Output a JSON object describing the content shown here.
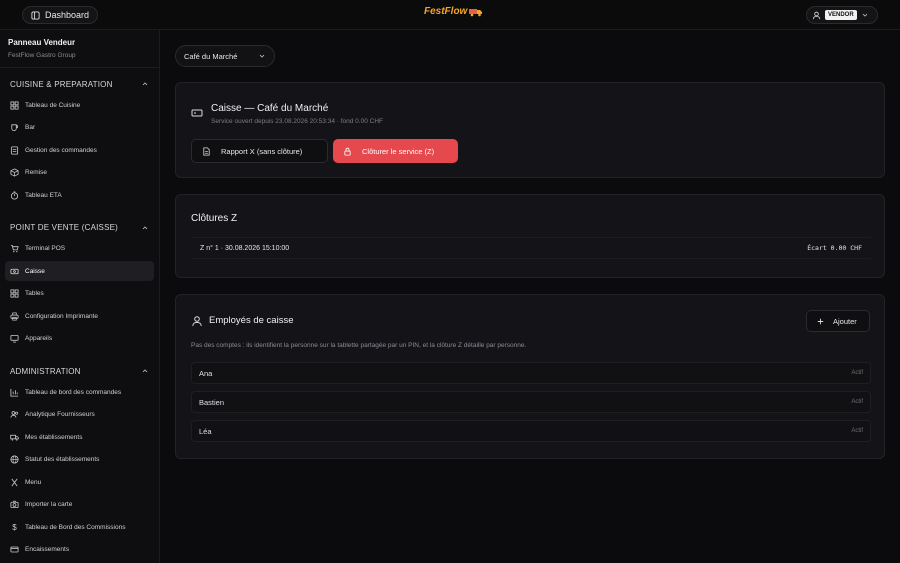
{
  "topbar": {
    "dashboard_label": "Dashboard",
    "logo_text": "FestFlow",
    "role_badge": "VENDOR"
  },
  "sidebar": {
    "title": "Panneau Vendeur",
    "subtitle": "FestFlow Gastro Group",
    "sections": [
      {
        "label": "CUISINE & PREPARATION",
        "items": [
          {
            "label": "Tableau de Cuisine",
            "icon": "grid-icon"
          },
          {
            "label": "Bar",
            "icon": "cup-icon"
          },
          {
            "label": "Gestion des commandes",
            "icon": "list-icon"
          },
          {
            "label": "Remise",
            "icon": "box-icon"
          },
          {
            "label": "Tableau ETA",
            "icon": "timer-icon"
          }
        ]
      },
      {
        "label": "POINT DE VENTE (CAISSE)",
        "items": [
          {
            "label": "Terminal POS",
            "icon": "cart-icon"
          },
          {
            "label": "Caisse",
            "icon": "register-icon"
          },
          {
            "label": "Tables",
            "icon": "grid-icon"
          },
          {
            "label": "Configuration Imprimante",
            "icon": "printer-icon"
          },
          {
            "label": "Appareils",
            "icon": "monitor-icon"
          }
        ]
      },
      {
        "label": "ADMINISTRATION",
        "items": [
          {
            "label": "Tableau de bord des commandes",
            "icon": "chart-icon"
          },
          {
            "label": "Analytique Fournisseurs",
            "icon": "users-icon"
          },
          {
            "label": "Mes établissements",
            "icon": "truck-icon"
          },
          {
            "label": "Statut des établissements",
            "icon": "globe-icon"
          },
          {
            "label": "Menu",
            "icon": "utensils-icon"
          },
          {
            "label": "Importer la carte",
            "icon": "camera-icon"
          },
          {
            "label": "Tableau de Bord des Commissions",
            "icon": "dollar-icon"
          },
          {
            "label": "Encaissements",
            "icon": "card-icon"
          }
        ]
      }
    ]
  },
  "main": {
    "venue": "Café du Marché",
    "register": {
      "title": "Caisse — Café du Marché",
      "subtitle": "Service ouvert depuis 23.08.2026 20:53:34 · fond 0.00 CHF",
      "report_x_label": "Rapport X (sans clôture)",
      "close_z_label": "Clôturer le service (Z)"
    },
    "closures": {
      "title": "Clôtures Z",
      "rows": [
        {
          "label": "Z n° 1 · 30.08.2026 15:10:00",
          "ecart": "Écart 0.00 CHF"
        }
      ]
    },
    "employees": {
      "title": "Employés de caisse",
      "add_label": "Ajouter",
      "description": "Pas des comptes : ils identifient la personne sur la tablette partagée par un PIN, et la clôture Z détaille par personne.",
      "list": [
        {
          "name": "Ana",
          "status": "Actif"
        },
        {
          "name": "Bastien",
          "status": "Actif"
        },
        {
          "name": "Léa",
          "status": "Actif"
        }
      ]
    }
  },
  "colors": {
    "accent_red": "#e5484d",
    "logo_orange": "#f5a623"
  }
}
